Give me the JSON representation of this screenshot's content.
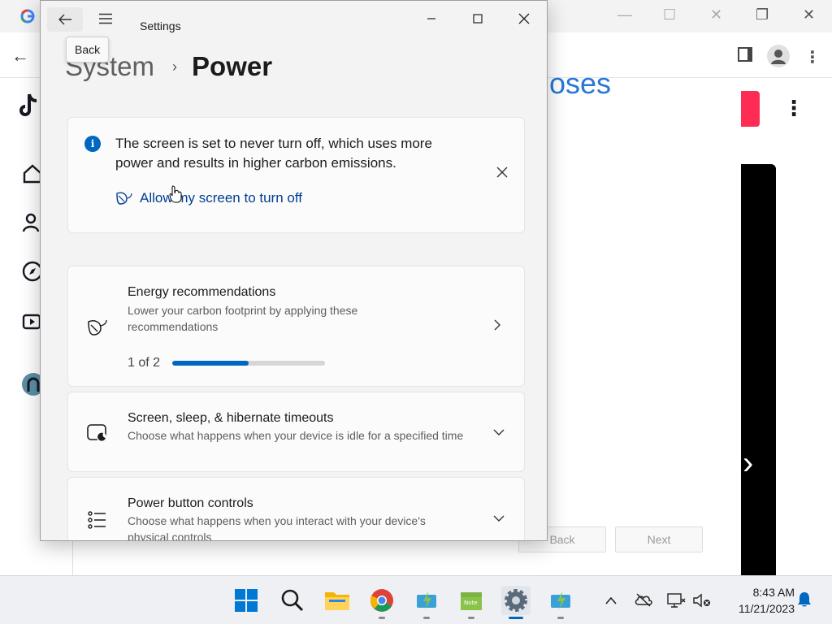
{
  "browser": {
    "heading_fragment": "oses",
    "pager_back_label": "Back",
    "pager_next_label": "Next"
  },
  "settings": {
    "window_title": "Settings",
    "tooltip": "Back",
    "breadcrumb": {
      "parent": "System",
      "current": "Power"
    },
    "notice": {
      "text": "The screen is set to never turn off, which uses more power and results in higher carbon emissions.",
      "link": "Allow my screen to turn off"
    },
    "cards": [
      {
        "title": "Energy recommendations",
        "description": "Lower your carbon footprint by applying these recommendations",
        "progress_label": "1 of 2",
        "progress_fraction": 0.5
      },
      {
        "title": "Screen, sleep, & hibernate timeouts",
        "description": "Choose what happens when your device is idle for a specified time"
      },
      {
        "title": "Power button controls",
        "description": "Choose what happens when you interact with your device's physical controls"
      }
    ]
  },
  "taskbar": {
    "time": "8:43 AM",
    "date": "11/21/2023"
  },
  "colors": {
    "accent": "#0067c0",
    "link": "#003e92",
    "tiktok_red": "#fe2c55"
  }
}
